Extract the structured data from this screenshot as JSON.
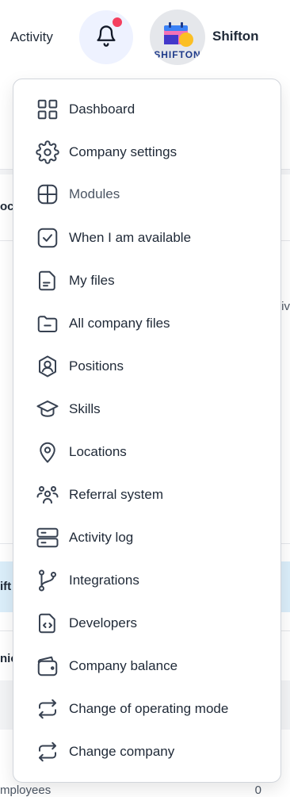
{
  "header": {
    "activity_label": "Activity",
    "user_name": "Shifton",
    "avatar_text": "SHIFTON",
    "notification_dot_color": "#f43f5e"
  },
  "background": {
    "frag_1": "oc",
    "frag_2": "tiv",
    "frag_3": "ift",
    "frag_4": "nic",
    "frag_5": "mployees",
    "frag_6": "0"
  },
  "menu": {
    "items": [
      {
        "label": "Dashboard",
        "icon": "grid-icon"
      },
      {
        "label": "Company settings",
        "icon": "gear-icon"
      },
      {
        "label": "Modules",
        "icon": "modules-icon"
      },
      {
        "label": "When I am available",
        "icon": "check-square-icon"
      },
      {
        "label": "My files",
        "icon": "file-icon"
      },
      {
        "label": "All company files",
        "icon": "folder-icon"
      },
      {
        "label": "Positions",
        "icon": "user-shield-icon"
      },
      {
        "label": "Skills",
        "icon": "graduation-cap-icon"
      },
      {
        "label": "Locations",
        "icon": "map-pin-icon"
      },
      {
        "label": "Referral system",
        "icon": "users-icon"
      },
      {
        "label": "Activity log",
        "icon": "server-icon"
      },
      {
        "label": "Integrations",
        "icon": "git-branch-icon"
      },
      {
        "label": "Developers",
        "icon": "code-file-icon"
      },
      {
        "label": "Company balance",
        "icon": "wallet-icon"
      },
      {
        "label": "Change of operating mode",
        "icon": "swap-icon"
      },
      {
        "label": "Change company",
        "icon": "swap-icon"
      }
    ]
  }
}
